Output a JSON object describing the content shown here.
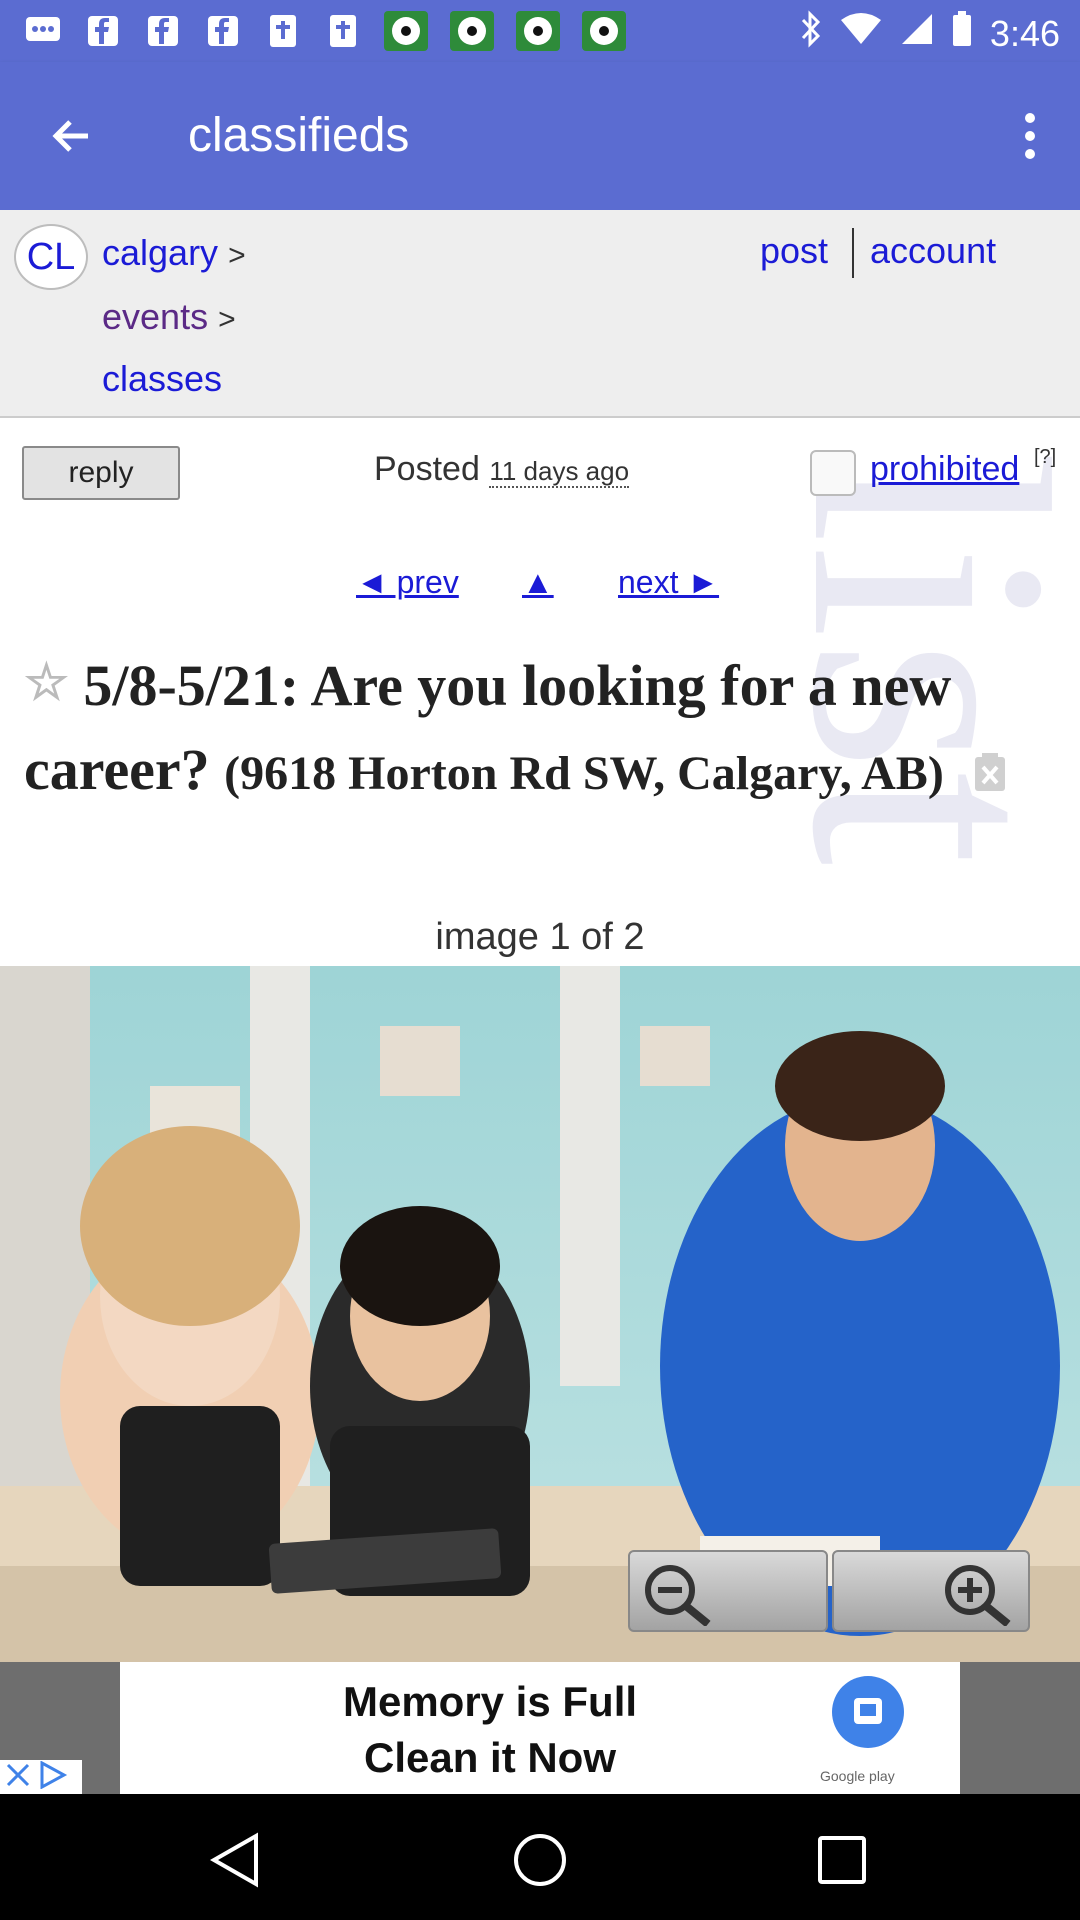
{
  "status_bar": {
    "time": "3:46",
    "notification_icons": [
      "message-icon",
      "facebook-icon",
      "facebook-icon",
      "facebook-icon",
      "bible-icon",
      "bible-icon",
      "soccer-ball-icon",
      "soccer-ball-icon",
      "soccer-ball-icon",
      "soccer-ball-icon"
    ],
    "system_icons": [
      "bluetooth-icon",
      "wifi-icon",
      "signal-icon",
      "battery-icon"
    ]
  },
  "app_bar": {
    "title": "classifieds",
    "color": "#5b6cd1"
  },
  "header": {
    "logo": "CL",
    "breadcrumb": [
      {
        "label": "calgary",
        "sep": ">"
      },
      {
        "label": "events",
        "sep": ">"
      },
      {
        "label": "classes",
        "sep": ""
      }
    ],
    "post": "post",
    "account": "account"
  },
  "actions": {
    "reply": "reply",
    "posted_label": "Posted",
    "posted_ago": "11 days ago",
    "prohibited": "prohibited",
    "help": "[?]"
  },
  "pager": {
    "prev": "◄ prev",
    "up": "▲",
    "next": "next ►"
  },
  "posting": {
    "title": "5/8-5/21: Are you looking for a new career?",
    "location": "(9618 Horton Rd SW, Calgary, AB)",
    "image_caption": "image 1 of 2"
  },
  "ad": {
    "line1": "Memory is Full",
    "line2": "Clean it Now",
    "store": "Google play"
  },
  "colors": {
    "link": "#1b1bd6",
    "visited": "#5b2a86",
    "header_bg": "#eeeeee"
  }
}
